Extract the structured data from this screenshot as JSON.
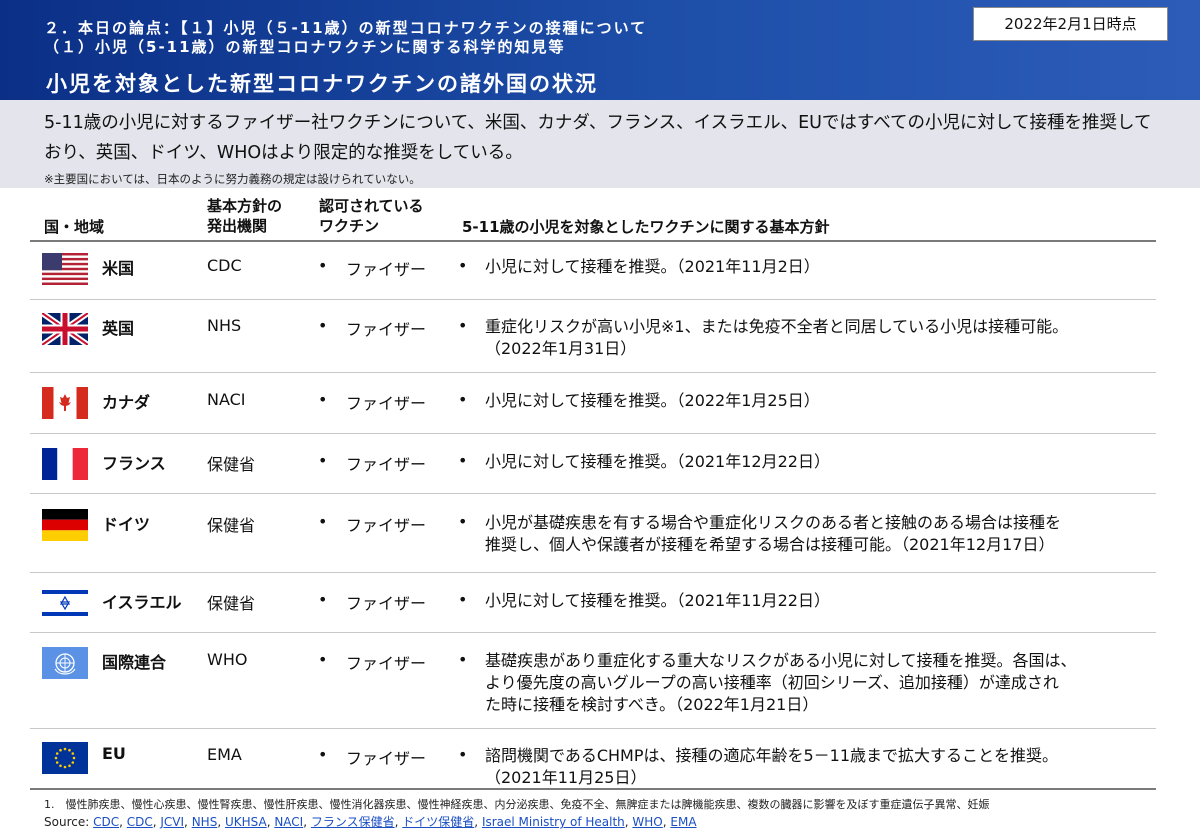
{
  "header": {
    "subtitle_line1": "２．本日の論点：【１】小児（５-11歳）の新型コロナワクチンの接種について",
    "subtitle_line2": "（１）小児（5-11歳）の新型コロナワクチンに関する科学的知見等",
    "title": "小児を対象とした新型コロナワクチンの諸外国の状況",
    "date_badge": "2022年2月1日時点"
  },
  "summary": {
    "lead": "5-11歳の小児に対するファイザー社ワクチンについて、米国、カナダ、フランス、イスラエル、EUではすべての小児に対して接種を推奨しており、英国、ドイツ、WHOはより限定的な推奨をしている。",
    "note": "※主要国においては、日本のように努力義務の規定は設けられていない。"
  },
  "table": {
    "headers": {
      "country": "国・地域",
      "agency_line1": "基本方針の",
      "agency_line2": "発出機関",
      "vaccine_line1": "認可されている",
      "vaccine_line2": "ワクチン",
      "policy": "5-11歳の小児を対象としたワクチンに関する基本方針"
    },
    "bullet": "•",
    "rows": [
      {
        "country": "米国",
        "flag": "us-flag",
        "agency": "CDC",
        "vaccine": "ファイザー",
        "policy_l1": "小児に対して接種を推奨。（2021年11月2日）",
        "policy_l2": "",
        "policy_l3": ""
      },
      {
        "country": "英国",
        "flag": "uk-flag",
        "agency": "NHS",
        "vaccine": "ファイザー",
        "policy_l1": "重症化リスクが高い小児※1、または免疫不全者と同居している小児は接種可能。",
        "policy_l2": "（2022年1月31日）",
        "policy_l3": ""
      },
      {
        "country": "カナダ",
        "flag": "canada-flag",
        "agency": "NACI",
        "vaccine": "ファイザー",
        "policy_l1": "小児に対して接種を推奨。（2022年1月25日）",
        "policy_l2": "",
        "policy_l3": ""
      },
      {
        "country": "フランス",
        "flag": "france-flag",
        "agency": "保健省",
        "vaccine": "ファイザー",
        "policy_l1": "小児に対して接種を推奨。（2021年12月22日）",
        "policy_l2": "",
        "policy_l3": ""
      },
      {
        "country": "ドイツ",
        "flag": "germany-flag",
        "agency": "保健省",
        "vaccine": "ファイザー",
        "policy_l1": "小児が基礎疾患を有する場合や重症化リスクのある者と接触のある場合は接種を",
        "policy_l2": "推奨し、個人や保護者が接種を希望する場合は接種可能。（2021年12月17日）",
        "policy_l3": ""
      },
      {
        "country": "イスラエル",
        "flag": "israel-flag",
        "agency": "保健省",
        "vaccine": "ファイザー",
        "policy_l1": "小児に対して接種を推奨。（2021年11月22日）",
        "policy_l2": "",
        "policy_l3": ""
      },
      {
        "country": "国際連合",
        "flag": "un-flag",
        "agency": "WHO",
        "vaccine": "ファイザー",
        "policy_l1": "基礎疾患があり重症化する重大なリスクがある小児に対して接種を推奨。各国は、",
        "policy_l2": "より優先度の高いグループの高い接種率（初回シリーズ、追加接種）が達成され",
        "policy_l3": "た時に接種を検討すべき。（2022年1月21日）"
      },
      {
        "country": "EU",
        "flag": "eu-flag",
        "agency": "EMA",
        "vaccine": "ファイザー",
        "policy_l1": "諮問機関であるCHMPは、接種の適応年齢を5－11歳まで拡大することを推奨。",
        "policy_l2": "（2021年11月25日）",
        "policy_l3": ""
      }
    ]
  },
  "footnote": "1.　慢性肺疾患、慢性心疾患、慢性腎疾患、慢性肝疾患、慢性消化器疾患、慢性神経疾患、内分泌疾患、免疫不全、無脾症または脾機能疾患、複数の臓器に影響を及ぼす重症遺伝子異常、妊娠",
  "source": {
    "label": "Source:",
    "links": [
      "CDC",
      "CDC",
      "JCVI",
      "NHS",
      "UKHSA",
      "NACI",
      "フランス保健省",
      "ドイツ保健省",
      "Israel Ministry of Health",
      "WHO",
      "EMA"
    ]
  },
  "colors": {
    "header_blue": "#0b2f86",
    "summary_bg": "#e4e4ec",
    "link_blue": "#1a4fc4"
  }
}
